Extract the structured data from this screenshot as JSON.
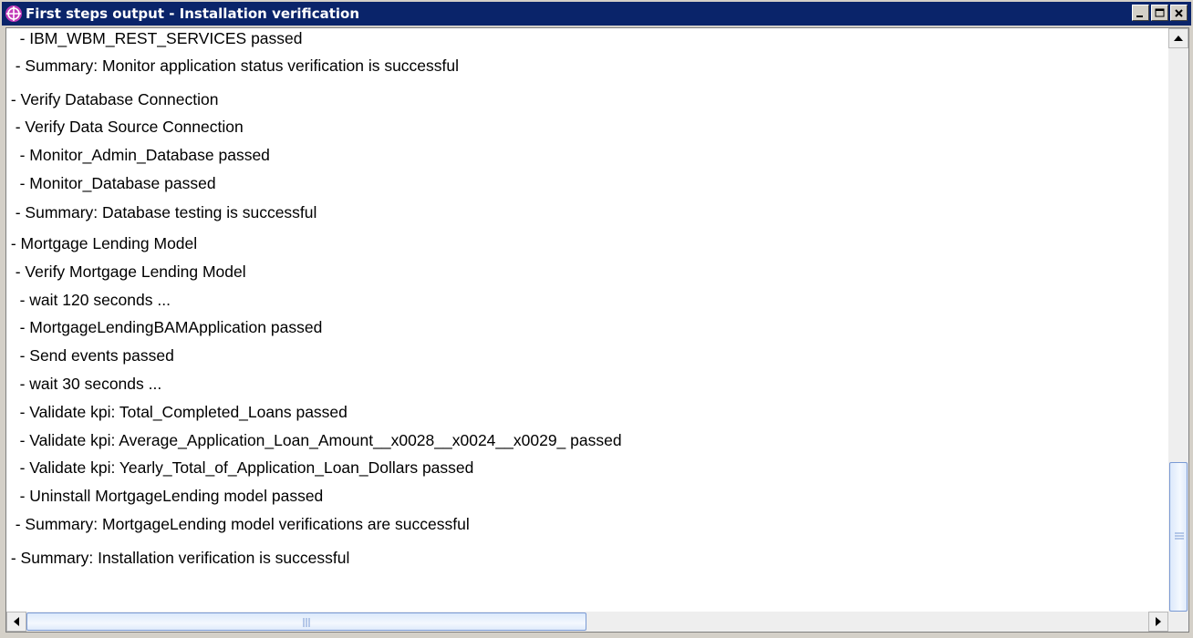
{
  "window": {
    "title": "First steps output  - Installation verification"
  },
  "log_lines": [
    "   - IBM_WBM_REST_SERVICES passed",
    "  - Summary: Monitor application status verification is successful",
    " - Verify Database Connection",
    "  - Verify Data Source Connection",
    "   - Monitor_Admin_Database passed",
    "   - Monitor_Database passed",
    "  - Summary: Database testing is successful",
    " - Mortgage Lending Model",
    "  - Verify Mortgage Lending Model",
    "   - wait 120 seconds ...",
    "   - MortgageLendingBAMApplication passed",
    "   - Send events passed",
    "   - wait 30 seconds ...",
    "   - Validate kpi: Total_Completed_Loans passed",
    "   - Validate kpi: Average_Application_Loan_Amount__x0028__x0024__x0029_ passed",
    "   - Validate kpi: Yearly_Total_of_Application_Loan_Dollars passed",
    "   - Uninstall MortgageLending model passed",
    "  - Summary: MortgageLending model verifications are successful",
    " - Summary: Installation verification is successful"
  ],
  "scrollbars": {
    "vertical_position": 1.0,
    "horizontal_position": 0.0
  },
  "colors": {
    "title_bar": "#0a246a",
    "title_text": "#ffffff",
    "scroll_thumb_border": "#7a9ad4"
  }
}
